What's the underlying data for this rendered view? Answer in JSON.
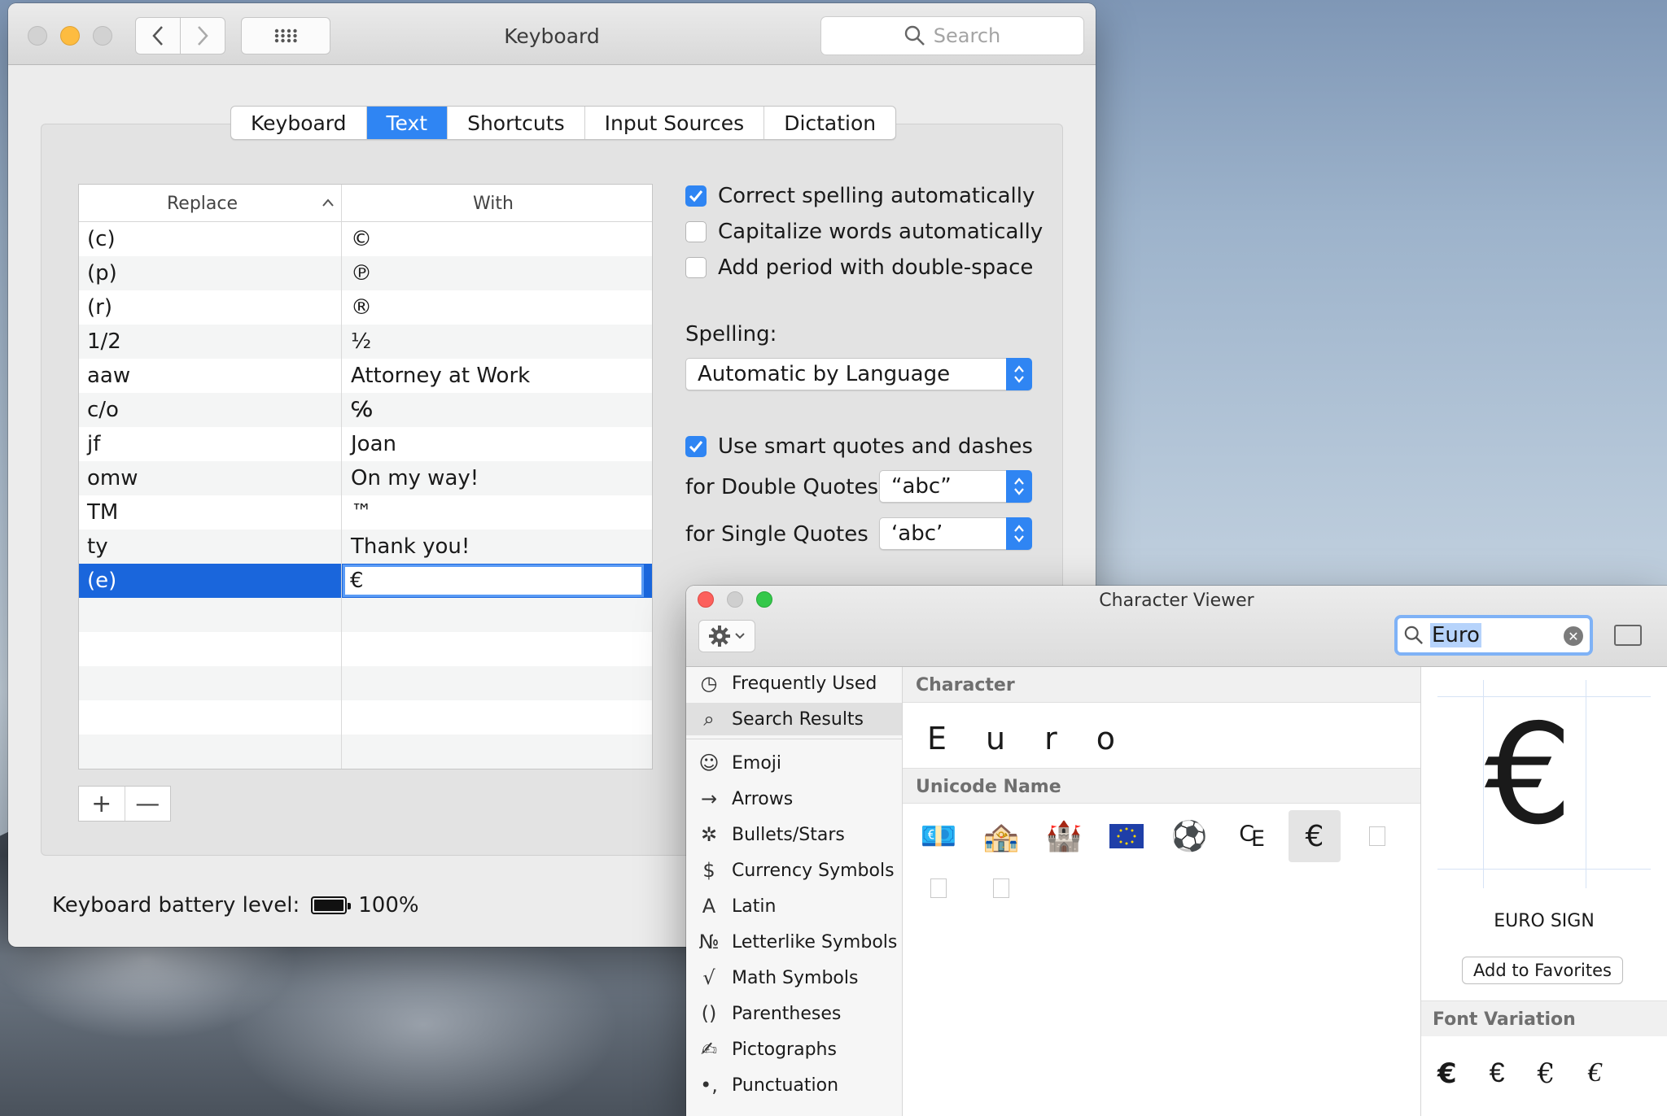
{
  "keyboard_window": {
    "title": "Keyboard",
    "search_placeholder": "Search",
    "tabs": [
      {
        "label": "Keyboard",
        "active": false
      },
      {
        "label": "Text",
        "active": true
      },
      {
        "label": "Shortcuts",
        "active": false
      },
      {
        "label": "Input Sources",
        "active": false
      },
      {
        "label": "Dictation",
        "active": false
      }
    ],
    "table": {
      "col_replace": "Replace",
      "col_with": "With",
      "rows": [
        {
          "replace": "(c)",
          "with": "©"
        },
        {
          "replace": "(p)",
          "with": "℗"
        },
        {
          "replace": "(r)",
          "with": "®"
        },
        {
          "replace": "1/2",
          "with": "½"
        },
        {
          "replace": "aaw",
          "with": "Attorney at Work"
        },
        {
          "replace": "c/o",
          "with": "℅"
        },
        {
          "replace": "jf",
          "with": "Joan"
        },
        {
          "replace": "omw",
          "with": "On my way!"
        },
        {
          "replace": "TM",
          "with": "™"
        },
        {
          "replace": "ty",
          "with": "Thank you!"
        }
      ],
      "editing_row": {
        "replace": "(e)",
        "with": "€"
      },
      "add_label": "+",
      "remove_label": "—"
    },
    "options": {
      "correct_spelling": {
        "label": "Correct spelling automatically",
        "checked": true
      },
      "capitalize": {
        "label": "Capitalize words automatically",
        "checked": false
      },
      "add_period": {
        "label": "Add period with double-space",
        "checked": false
      },
      "smart_quotes": {
        "label": "Use smart quotes and dashes",
        "checked": true
      }
    },
    "spelling_label": "Spelling:",
    "spelling_value": "Automatic by Language",
    "double_quotes_label": "for Double Quotes",
    "double_quotes_value": "“abc”",
    "single_quotes_label": "for Single Quotes",
    "single_quotes_value": "‘abc’",
    "battery_label": "Keyboard battery level:",
    "battery_value": "100%",
    "battery_level": 1.0
  },
  "character_viewer": {
    "title": "Character Viewer",
    "search_value": "Euro",
    "sidebar": [
      {
        "icon": "clock-icon",
        "glyph": "◷",
        "label": "Frequently Used"
      },
      {
        "icon": "search-icon",
        "glyph": "⌕",
        "label": "Search Results",
        "selected": true
      },
      {
        "icon": "smiley-icon",
        "glyph": "☺",
        "label": "Emoji"
      },
      {
        "icon": "arrow-icon",
        "glyph": "→",
        "label": "Arrows"
      },
      {
        "icon": "asterisk-icon",
        "glyph": "✲",
        "label": "Bullets/Stars"
      },
      {
        "icon": "dollar-icon",
        "glyph": "$",
        "label": "Currency Symbols"
      },
      {
        "icon": "latin-a-icon",
        "glyph": "A",
        "label": "Latin"
      },
      {
        "icon": "numero-icon",
        "glyph": "№",
        "label": "Letterlike Symbols"
      },
      {
        "icon": "sqrt-icon",
        "glyph": "√",
        "label": "Math Symbols"
      },
      {
        "icon": "parentheses-icon",
        "glyph": "()",
        "label": "Parentheses"
      },
      {
        "icon": "pictograph-icon",
        "glyph": "✍",
        "label": "Pictographs"
      },
      {
        "icon": "punctuation-icon",
        "glyph": "•,",
        "label": "Punctuation"
      }
    ],
    "character_header": "Character",
    "character_letters": [
      "E",
      "u",
      "r",
      "o"
    ],
    "unicode_header": "Unicode Name",
    "results": [
      {
        "icon": "euro-banknote-icon",
        "glyph": "💶"
      },
      {
        "icon": "european-post-office-icon",
        "glyph": "🏤"
      },
      {
        "icon": "european-castle-icon",
        "glyph": "🏰"
      },
      {
        "icon": "eu-flag-icon",
        "glyph": "🇪🇺"
      },
      {
        "icon": "soccer-ball-icon",
        "glyph": "⚽"
      },
      {
        "icon": "euro-currency-sign-icon",
        "glyph": "₠"
      },
      {
        "icon": "euro-sign-icon",
        "glyph": "€",
        "selected": true
      },
      {
        "icon": "missing-glyph-icon",
        "glyph": ""
      },
      {
        "icon": "missing-glyph-icon",
        "glyph": ""
      },
      {
        "icon": "missing-glyph-icon",
        "glyph": ""
      }
    ],
    "detail": {
      "glyph": "€",
      "name": "EURO SIGN",
      "add_favorites": "Add to Favorites",
      "font_variation_header": "Font Variation",
      "variations": [
        "€",
        "€",
        "€",
        "€"
      ]
    }
  },
  "colors": {
    "accent": "#2f85f3",
    "selection": "#1a66dc",
    "close": "#fc605c",
    "minimize": "#fdbc40",
    "zoom": "#34c84a"
  }
}
